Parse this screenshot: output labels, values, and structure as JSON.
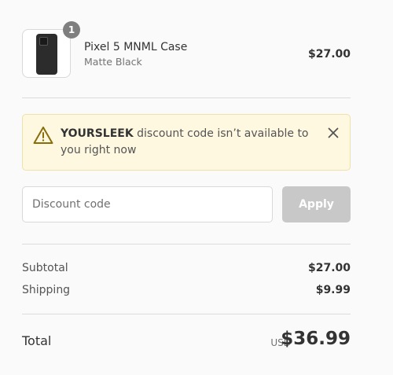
{
  "product": {
    "name": "Pixel 5 MNML Case",
    "variant": "Matte Black",
    "price": "$27.00",
    "quantity": "1",
    "image_icon": "phone-case-icon"
  },
  "notice": {
    "code": "YOURSLEEK",
    "message": " discount code isn’t available to you right now",
    "icon": "warning-icon",
    "close_icon": "close-icon",
    "colors": {
      "background": "#fff8e1",
      "border": "#f0e0a9",
      "icon": "#8a6d0b"
    }
  },
  "discount": {
    "placeholder": "Discount code",
    "value": "",
    "apply_label": "Apply"
  },
  "summary": {
    "subtotal_label": "Subtotal",
    "subtotal_value": "$27.00",
    "shipping_label": "Shipping",
    "shipping_value": "$9.99",
    "total_label": "Total",
    "currency": "USD",
    "total_value": "$36.99"
  }
}
